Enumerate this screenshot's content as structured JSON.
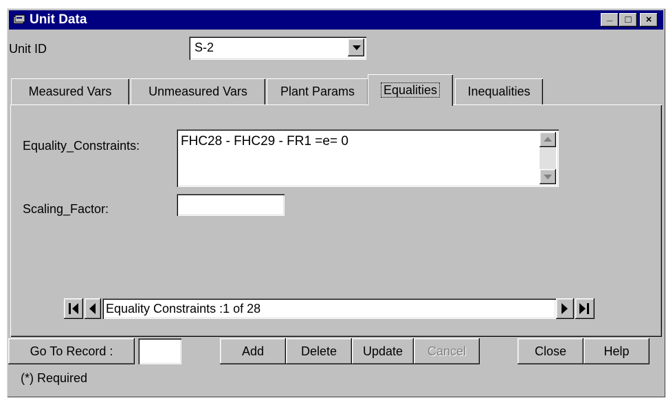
{
  "window": {
    "title": "Unit Data",
    "controls": {
      "minimize": "_",
      "maximize": "□",
      "close": "×"
    }
  },
  "unit_id": {
    "label": "Unit ID",
    "value": "S-2"
  },
  "tabs": [
    {
      "label": "Measured Vars",
      "active": false
    },
    {
      "label": "Unmeasured Vars",
      "active": false
    },
    {
      "label": "Plant Params",
      "active": false
    },
    {
      "label": "Equalities",
      "active": true
    },
    {
      "label": "Inequalities",
      "active": false
    }
  ],
  "equalities": {
    "constraints_label": "Equality_Constraints:",
    "constraints_value": "FHC28 - FHC29 - FR1 =e= 0",
    "scaling_label": "Scaling_Factor:",
    "scaling_value": ""
  },
  "navigator": {
    "caption": "Equality Constraints :1 of 28"
  },
  "buttons": {
    "goto": "Go To Record :",
    "goto_value": "",
    "add": "Add",
    "delete": "Delete",
    "update": "Update",
    "cancel": "Cancel",
    "close": "Close",
    "help": "Help"
  },
  "footer": {
    "required_note": "(*) Required"
  },
  "colors": {
    "titlebar": "#000080",
    "face": "#c0c0c0"
  }
}
